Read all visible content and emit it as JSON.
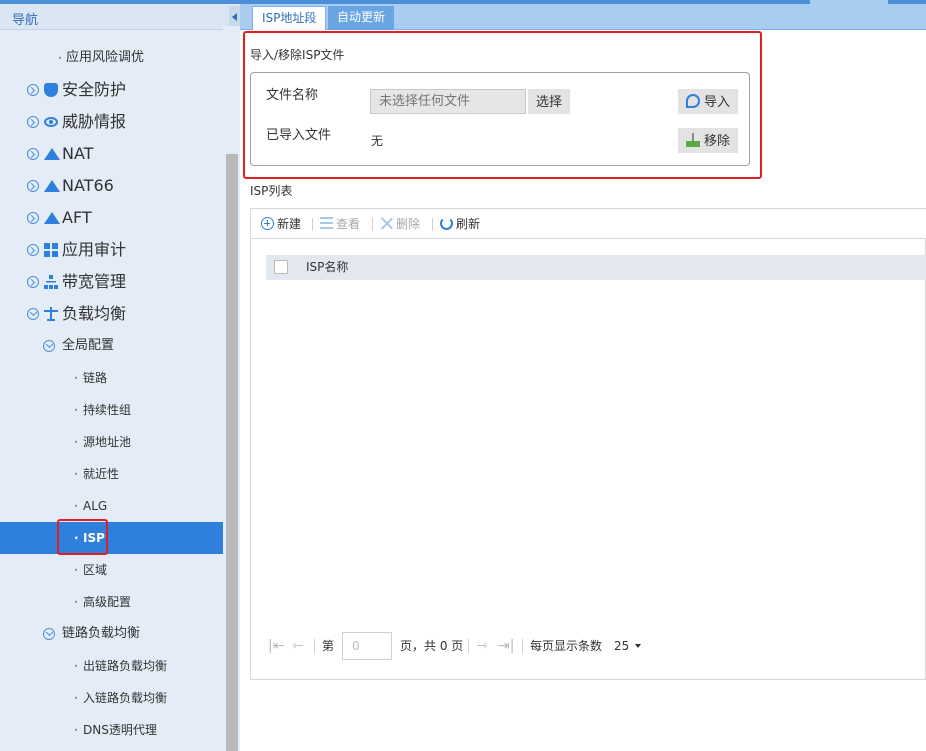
{
  "sidebar": {
    "title": "导航",
    "items": [
      {
        "label": "应用风险调优"
      },
      {
        "label": "安全防护"
      },
      {
        "label": "威胁情报"
      },
      {
        "label": "NAT"
      },
      {
        "label": "NAT66"
      },
      {
        "label": "AFT"
      },
      {
        "label": "应用审计"
      },
      {
        "label": "带宽管理"
      },
      {
        "label": "负载均衡"
      },
      {
        "label": "全局配置"
      },
      {
        "label": "链路"
      },
      {
        "label": "持续性组"
      },
      {
        "label": "源地址池"
      },
      {
        "label": "就近性"
      },
      {
        "label": "ALG"
      },
      {
        "label": "ISP"
      },
      {
        "label": "区域"
      },
      {
        "label": "高级配置"
      },
      {
        "label": "链路负载均衡"
      },
      {
        "label": "出链路负载均衡"
      },
      {
        "label": "入链路负载均衡"
      },
      {
        "label": "DNS透明代理"
      }
    ]
  },
  "tabs": [
    {
      "label": "ISP地址段",
      "active": true
    },
    {
      "label": "自动更新",
      "active": false
    }
  ],
  "import_section": {
    "title": "导入/移除ISP文件",
    "file_name_label": "文件名称",
    "file_placeholder": "未选择任何文件",
    "select_button": "选择",
    "import_button": "导入",
    "imported_label": "已导入文件",
    "imported_value": "无",
    "remove_button": "移除"
  },
  "isp_list": {
    "title": "ISP列表",
    "toolbar": {
      "new": "新建",
      "view": "查看",
      "delete": "删除",
      "refresh": "刷新"
    },
    "column": "ISP名称",
    "pager": {
      "page_prefix": "第",
      "page_value": "0",
      "page_suffix": "页，共 0 页",
      "per_page_label": "每页显示条数",
      "per_page_value": "25"
    }
  },
  "colors": {
    "accent": "#2f7fdc",
    "highlight": "#e02020",
    "tab_bar": "#a9cdf0"
  }
}
